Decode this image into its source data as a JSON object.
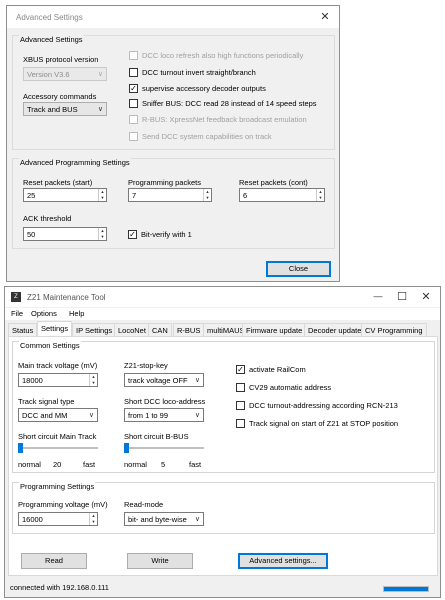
{
  "advanced_dialog": {
    "title": "Advanced Settings",
    "close_icon": "close-icon",
    "group_advanced": {
      "title": "Advanced Settings",
      "xbus_label": "XBUS protocol version",
      "xbus_value": "Version V3.6",
      "accessory_label": "Accessory commands",
      "accessory_value": "Track and BUS",
      "checkboxes": [
        {
          "label": "DCC loco refresh also high functions periodically",
          "checked": false,
          "enabled": false
        },
        {
          "label": "DCC turnout invert straight/branch",
          "checked": false,
          "enabled": true
        },
        {
          "label": "supervise accessory decoder outputs",
          "checked": true,
          "enabled": true
        },
        {
          "label": "Sniffer BUS: DCC read 28 instead of 14 speed steps",
          "checked": false,
          "enabled": true
        },
        {
          "label": "R-BUS: XpressNet feedback broadcast emulation",
          "checked": false,
          "enabled": false
        },
        {
          "label": "Send DCC system capabilities on track",
          "checked": false,
          "enabled": false
        }
      ]
    },
    "group_programming": {
      "title": "Advanced Programming Settings",
      "reset_start_label": "Reset packets (start)",
      "reset_start_value": "25",
      "programming_packets_label": "Programming packets",
      "programming_packets_value": "7",
      "reset_cont_label": "Reset packets (cont)",
      "reset_cont_value": "6",
      "ack_label": "ACK threshold",
      "ack_value": "50",
      "bit_verify_label": "Bit-verify with 1",
      "bit_verify_checked": true
    },
    "close_button": "Close"
  },
  "main_window": {
    "title": "Z21 Maintenance Tool",
    "minimize": "—",
    "maximize": "☐",
    "close": "✕",
    "menu": [
      "File",
      "Options",
      "Help"
    ],
    "tabs": [
      "Status",
      "Settings",
      "IP Settings",
      "LocoNet",
      "CAN",
      "R-BUS",
      "multiMAUS",
      "Firmware update",
      "Decoder update",
      "CV Programming"
    ],
    "active_tab": "Settings",
    "common": {
      "title": "Common Settings",
      "main_voltage_label": "Main track voltage (mV)",
      "main_voltage_value": "18000",
      "stop_key_label": "Z21-stop-key",
      "stop_key_value": "track voltage OFF",
      "track_signal_label": "Track signal type",
      "track_signal_value": "DCC and MM",
      "short_dcc_label": "Short DCC loco-address",
      "short_dcc_value": "from 1 to 99",
      "short_main_label": "Short circuit Main Track",
      "short_main_ticks": [
        "normal",
        "20",
        "fast"
      ],
      "short_main_level": 0,
      "short_bbus_label": "Short circuit B-BUS",
      "short_bbus_ticks": [
        "normal",
        "5",
        "fast"
      ],
      "short_bbus_level": 0,
      "checkboxes": [
        {
          "label": "activate RailCom",
          "checked": true
        },
        {
          "label": "CV29 automatic address",
          "checked": false
        },
        {
          "label": "DCC turnout-addressing according RCN-213",
          "checked": false
        },
        {
          "label": "Track signal on start of Z21 at STOP position",
          "checked": false
        }
      ]
    },
    "programming": {
      "title": "Programming Settings",
      "voltage_label": "Programming voltage (mV)",
      "voltage_value": "16000",
      "read_mode_label": "Read-mode",
      "read_mode_value": "bit- and byte-wise"
    },
    "buttons": {
      "read": "Read",
      "write": "Write",
      "advanced": "Advanced settings..."
    },
    "status_text": "connected with 192.168.0.111",
    "progress": 1.0
  }
}
